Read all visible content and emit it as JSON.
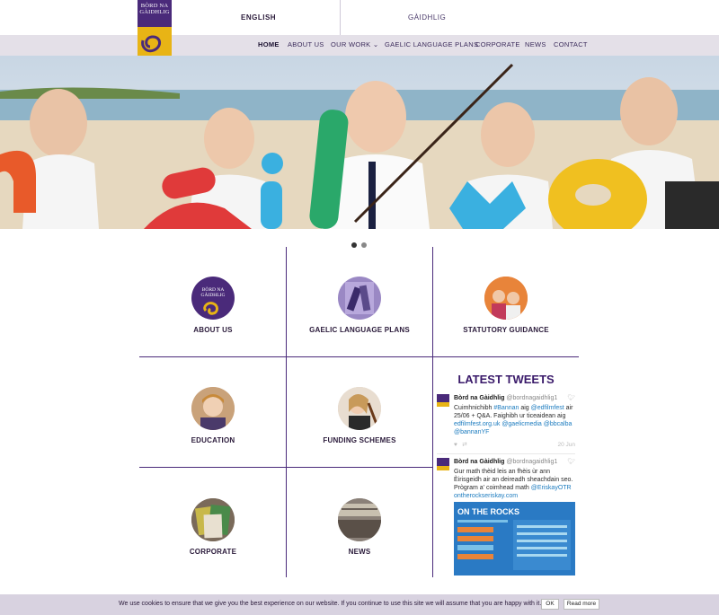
{
  "header": {
    "logo_text": "BÒRD NA GÀIDHLIG",
    "lang_english": "ENGLISH",
    "lang_gaelic": "GÀIDHLIG"
  },
  "nav": {
    "items": [
      "HOME",
      "ABOUT US",
      "OUR WORK",
      "GAELIC LANGUAGE PLANS",
      "CORPORATE",
      "NEWS",
      "CONTACT"
    ],
    "active": "HOME"
  },
  "hero": {
    "slide_count": 2,
    "active_slide": 1
  },
  "tiles": [
    {
      "label": "ABOUT US"
    },
    {
      "label": "GAELIC LANGUAGE PLANS"
    },
    {
      "label": "STATUTORY GUIDANCE"
    },
    {
      "label": "EDUCATION"
    },
    {
      "label": "FUNDING SCHEMES"
    },
    {
      "label": "CORPORATE"
    },
    {
      "label": "NEWS"
    }
  ],
  "tweets": {
    "title": "LATEST TWEETS",
    "items": [
      {
        "name": "Bòrd na Gàidhlig",
        "handle": "@bordnagaidhlig1",
        "text_parts": [
          "Cuimhnichibh ",
          "#Bannan",
          " aig ",
          "@edfilmfest",
          " air 25/06 + Q&A. Faighibh ur ticeaidean aig ",
          "edfilmfest.org.uk",
          " ",
          "@gaelicmedia",
          " ",
          "@bbcalba",
          " ",
          "@bannanYF"
        ],
        "date": "20 Jun"
      },
      {
        "name": "Bòrd na Gàidhlig",
        "handle": "@bordnagaidhlig1",
        "text_parts": [
          "Gur math thèid leis an fhèis ùr ann Èirisgeidh air an deireadh sheachdain seo. Prògram a' coimhead math ",
          "@EriskayOTR",
          " ",
          "ontherockseriskay.com"
        ],
        "image_title": "ON THE ROCKS"
      }
    ]
  },
  "cookie": {
    "text": "We use cookies to ensure that we give you the best experience on our website. If you continue to use this site we will assume that you are happy with it.",
    "ok": "OK",
    "read_more": "Read more"
  },
  "colors": {
    "brand_purple": "#4a2a7a",
    "brand_gold": "#e8b415",
    "nav_bg": "#e4e0e8",
    "link_blue": "#1b7bbf"
  }
}
